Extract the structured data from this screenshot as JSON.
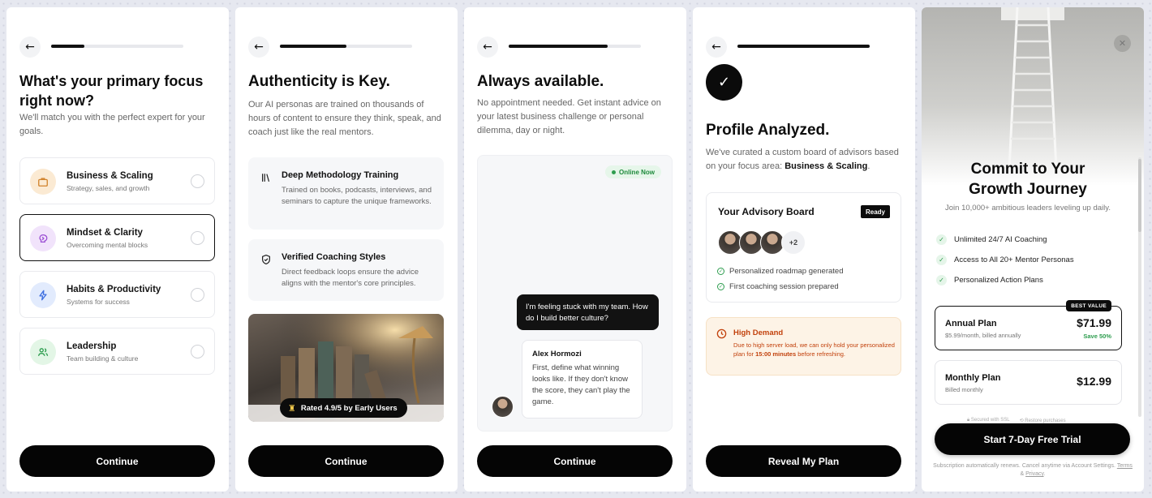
{
  "screen1": {
    "progress": 0.25,
    "title": "What's your primary focus right now?",
    "subtitle": "We'll match you with the perfect expert for your goals.",
    "options": [
      {
        "title": "Business & Scaling",
        "desc": "Strategy, sales, and growth",
        "icon": "briefcase-icon",
        "color": "#fbead3",
        "selected": false
      },
      {
        "title": "Mindset & Clarity",
        "desc": "Overcoming mental blocks",
        "icon": "brain-icon",
        "color": "#f1e3fb",
        "selected": true
      },
      {
        "title": "Habits & Productivity",
        "desc": "Systems for success",
        "icon": "lightning-icon",
        "color": "#e2ebfd",
        "selected": false
      },
      {
        "title": "Leadership",
        "desc": "Team building & culture",
        "icon": "users-icon",
        "color": "#e3f6e6",
        "selected": false
      }
    ],
    "cta": "Continue"
  },
  "screen2": {
    "progress": 0.5,
    "title": "Authenticity is Key.",
    "subtitle": "Our AI personas are trained on thousands of hours of content to ensure they think, speak, and coach just like the real mentors.",
    "features": [
      {
        "title": "Deep Methodology Training",
        "desc": "Trained on books, podcasts, interviews, and seminars to capture the unique frameworks.",
        "icon": "library-icon"
      },
      {
        "title": "Verified Coaching Styles",
        "desc": "Direct feedback loops ensure the advice aligns with the mentor's core principles.",
        "icon": "shield-check-icon"
      }
    ],
    "badge": "Rated 4.9/5 by Early Users",
    "cta": "Continue"
  },
  "screen3": {
    "progress": 0.75,
    "title": "Always available.",
    "subtitle": "No appointment needed. Get instant advice on your latest business challenge or personal dilemma, day or night.",
    "status": "Online Now",
    "user_message": "I'm feeling stuck with my team. How do I build better culture?",
    "mentor_name": "Alex Hormozi",
    "mentor_message": "First, define what winning looks like. If they don't know the score, they can't play the game.",
    "cta": "Continue"
  },
  "screen4": {
    "progress": 1.0,
    "title": "Profile Analyzed.",
    "subtitle_prefix": "We've curated a custom board of advisors based on your focus area: ",
    "focus_area": "Business & Scaling",
    "subtitle_suffix": ".",
    "board_title": "Your Advisory Board",
    "board_badge": "Ready",
    "more_count": "+2",
    "checklist": [
      "Personalized roadmap generated",
      "First coaching session prepared"
    ],
    "alert_title": "High Demand",
    "alert_pre": "Due to high server load, we can only hold your personalized plan for ",
    "alert_time": "15:00 minutes",
    "alert_post": " before refreshing.",
    "cta": "Reveal My Plan"
  },
  "screen5": {
    "title": "Commit to Your Growth Journey",
    "subtitle": "Join 10,000+ ambitious leaders leveling up daily.",
    "perks": [
      "Unlimited 24/7 AI Coaching",
      "Access to All 20+ Mentor Personas",
      "Personalized Action Plans"
    ],
    "plans": [
      {
        "name": "Annual Plan",
        "desc": "$5.99/month, billed annually",
        "price": "$71.99",
        "save": "Save 50%",
        "badge": "BEST VALUE",
        "selected": true
      },
      {
        "name": "Monthly Plan",
        "desc": "Billed monthly",
        "price": "$12.99",
        "selected": false
      }
    ],
    "secure": "Secured with SSL",
    "restore": "Restore purchases",
    "cta": "Start 7-Day Free Trial",
    "footer_pre": "Subscription automatically renews. Cancel anytime via Account Settings. ",
    "terms": "Terms",
    "amp": " & ",
    "privacy": "Privacy",
    "footer_end": "."
  },
  "colors": {
    "primary": "#050505",
    "success": "#2e9d4f",
    "warning": "#c2410c",
    "online_bg": "#e6f6ea"
  }
}
